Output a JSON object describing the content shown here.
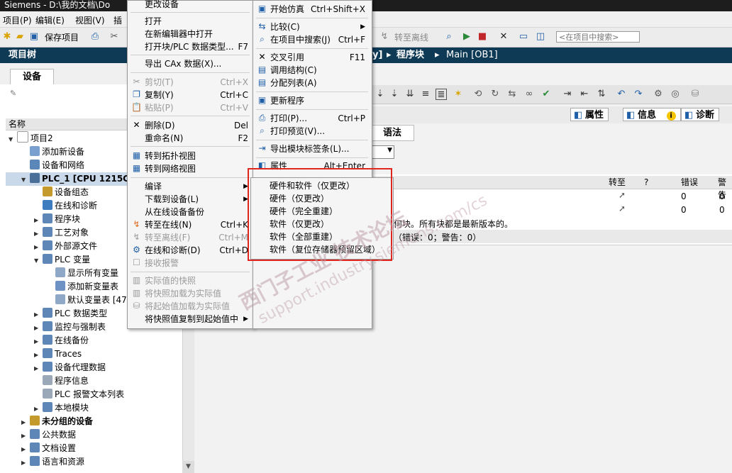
{
  "window": {
    "title": "Siemens  -  D:\\我的文档\\Do"
  },
  "menubar": {
    "items": [
      "项目(P)",
      "编辑(E)",
      "视图(V)",
      "插"
    ]
  },
  "toolbar": {
    "save_label": "保存项目",
    "go_offline": "转至离线",
    "search_placeholder": "<在项目中搜索>"
  },
  "project_tree": {
    "title": "项目树",
    "device_tab": "设备",
    "name_header": "名称",
    "items": [
      {
        "label": "项目2",
        "level": 0
      },
      {
        "label": "添加新设备",
        "level": 1
      },
      {
        "label": "设备和网络",
        "level": 1
      },
      {
        "label": "PLC_1 [CPU 1215C AC",
        "level": 1
      },
      {
        "label": "设备组态",
        "level": 2
      },
      {
        "label": "在线和诊断",
        "level": 2
      },
      {
        "label": "程序块",
        "level": 2
      },
      {
        "label": "工艺对象",
        "level": 2
      },
      {
        "label": "外部源文件",
        "level": 2
      },
      {
        "label": "PLC 变量",
        "level": 2
      },
      {
        "label": "显示所有变量",
        "level": 3
      },
      {
        "label": "添加新变量表",
        "level": 3
      },
      {
        "label": "默认变量表 [47",
        "level": 3
      },
      {
        "label": "PLC 数据类型",
        "level": 2
      },
      {
        "label": "监控与强制表",
        "level": 2
      },
      {
        "label": "在线备份",
        "level": 2
      },
      {
        "label": "Traces",
        "level": 2
      },
      {
        "label": "设备代理数据",
        "level": 2
      },
      {
        "label": "程序信息",
        "level": 2
      },
      {
        "label": "PLC 报警文本列表",
        "level": 2
      },
      {
        "label": "本地模块",
        "level": 2
      },
      {
        "label": "未分组的设备",
        "level": 0
      },
      {
        "label": "公共数据",
        "level": 0
      },
      {
        "label": "文档设置",
        "level": 0
      },
      {
        "label": "语言和资源",
        "level": 0
      }
    ]
  },
  "editor": {
    "breadcrumb_tail": "y]",
    "sep1": "▸",
    "program_blocks": "程序块",
    "sep2": "▸",
    "main": "Main [OB1]"
  },
  "inspector": {
    "properties": "属性",
    "info": "信息",
    "diagnostics": "诊断",
    "syntax_tab": "语法"
  },
  "grid": {
    "headers": [
      "转至",
      "?",
      "错误",
      "警告"
    ],
    "rows": [
      {
        "errors": "0",
        "warnings": "0"
      },
      {
        "errors": "0",
        "warnings": "0"
      }
    ],
    "message": "何块。所有块都是最新版本的。",
    "summary": "（错误：0；警告：0）"
  },
  "context_menu_left": [
    {
      "label": "更改设备",
      "shortcut": ""
    },
    {
      "label": "打开",
      "shortcut": ""
    },
    {
      "label": "在新编辑器中打开",
      "shortcut": ""
    },
    {
      "label": "打开块/PLC 数据类型...",
      "shortcut": "F7"
    },
    {
      "label": "导出 CAx 数据(X)...",
      "shortcut": ""
    },
    {
      "label": "剪切(T)",
      "shortcut": "Ctrl+X",
      "disabled": true
    },
    {
      "label": "复制(Y)",
      "shortcut": "Ctrl+C"
    },
    {
      "label": "粘贴(P)",
      "shortcut": "Ctrl+V",
      "disabled": true
    },
    {
      "label": "删除(D)",
      "shortcut": "Del"
    },
    {
      "label": "重命名(N)",
      "shortcut": "F2"
    },
    {
      "label": "转到拓扑视图",
      "shortcut": ""
    },
    {
      "label": "转到网络视图",
      "shortcut": ""
    },
    {
      "label": "编译",
      "shortcut": "▶"
    },
    {
      "label": "下载到设备(L)",
      "shortcut": "▶"
    },
    {
      "label": "从在线设备备份",
      "shortcut": ""
    },
    {
      "label": "转至在线(N)",
      "shortcut": "Ctrl+K"
    },
    {
      "label": "转至离线(F)",
      "shortcut": "Ctrl+M",
      "disabled": true
    },
    {
      "label": "在线和诊断(D)",
      "shortcut": "Ctrl+D"
    },
    {
      "label": "接收报警",
      "shortcut": "",
      "disabled": true
    },
    {
      "label": "实际值的快照",
      "shortcut": "",
      "disabled": true
    },
    {
      "label": "将快照加载为实际值",
      "shortcut": "",
      "disabled": true
    },
    {
      "label": "将起始值加载为实际值",
      "shortcut": "",
      "disabled": true
    },
    {
      "label": "将快照值复制到起始值中",
      "shortcut": "▶"
    }
  ],
  "context_menu_right": [
    {
      "label": "开始仿真",
      "shortcut": "Ctrl+Shift+X"
    },
    {
      "label": "比较(C)",
      "shortcut": "▶"
    },
    {
      "label": "在项目中搜索(J)",
      "shortcut": "Ctrl+F"
    },
    {
      "label": "交叉引用",
      "shortcut": "F11"
    },
    {
      "label": "调用结构(C)",
      "shortcut": ""
    },
    {
      "label": "分配列表(A)",
      "shortcut": ""
    },
    {
      "label": "更新程序",
      "shortcut": ""
    },
    {
      "label": "打印(P)...",
      "shortcut": "Ctrl+P"
    },
    {
      "label": "打印预览(V)...",
      "shortcut": ""
    },
    {
      "label": "导出模块标签条(L)...",
      "shortcut": ""
    },
    {
      "label": "属性",
      "shortcut": "Alt+Enter"
    }
  ],
  "submenu_download": [
    {
      "label": "硬件和软件（仅更改）"
    },
    {
      "label": "硬件（仅更改）"
    },
    {
      "label": "硬件（完全重建）"
    },
    {
      "label": "软件（仅更改）"
    },
    {
      "label": "软件（全部重建）"
    },
    {
      "label": "软件（复位存储器预留区域）"
    }
  ],
  "watermark": {
    "line1": "西门子工业  技术论坛",
    "line2": "support.industry.siemens.com/cs"
  },
  "colors": {
    "highlight": "#e0261f",
    "panel_header": "#0f3a56"
  }
}
